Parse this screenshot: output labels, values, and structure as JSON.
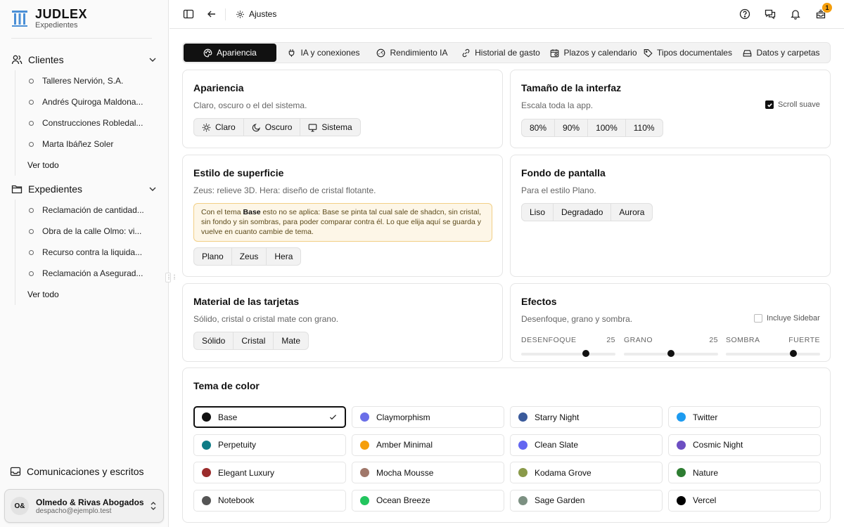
{
  "brand": {
    "title": "JUDLEX",
    "subtitle": "Expedientes"
  },
  "sidebar": {
    "clientes": {
      "label": "Clientes",
      "items": [
        "Talleres Nervión, S.A.",
        "Andrés Quiroga Maldona...",
        "Construcciones Robledal...",
        "Marta Ibáñez Soler"
      ],
      "all": "Ver todo"
    },
    "expedientes": {
      "label": "Expedientes",
      "items": [
        "Reclamación de cantidad...",
        "Obra de la calle Olmo: vi...",
        "Recurso contra la liquida...",
        "Reclamación a Asegurad..."
      ],
      "all": "Ver todo"
    },
    "comunicaciones": "Comunicaciones y escritos",
    "account": {
      "initials": "O&",
      "name": "Olmedo & Rivas Abogados",
      "email": "despacho@ejemplo.test"
    }
  },
  "topbar": {
    "breadcrumb": "Ajustes",
    "notifications_badge": "1"
  },
  "tabs": [
    {
      "label": "Apariencia",
      "icon": "palette-icon",
      "active": true
    },
    {
      "label": "IA y conexiones",
      "icon": "plug-icon"
    },
    {
      "label": "Rendimiento IA",
      "icon": "gauge-icon"
    },
    {
      "label": "Historial de gasto",
      "icon": "link-icon"
    },
    {
      "label": "Plazos y calendario",
      "icon": "calendar-icon"
    },
    {
      "label": "Tipos documentales",
      "icon": "tag-icon"
    },
    {
      "label": "Datos y carpetas",
      "icon": "drive-icon"
    }
  ],
  "apariencia": {
    "title": "Apariencia",
    "subtitle": "Claro, oscuro o el del sistema.",
    "options": [
      "Claro",
      "Oscuro",
      "Sistema"
    ]
  },
  "tamano": {
    "title": "Tamaño de la interfaz",
    "subtitle": "Escala toda la app.",
    "options": [
      "80%",
      "90%",
      "100%",
      "110%"
    ],
    "scroll_label": "Scroll suave",
    "scroll_checked": true
  },
  "superficie": {
    "title": "Estilo de superficie",
    "subtitle": "Zeus: relieve 3D. Hera: diseño de cristal flotante.",
    "note_pre": "Con el tema ",
    "note_bold": "Base",
    "note_post": " esto no se aplica: Base se pinta tal cual sale de shadcn, sin cristal, sin fondo y sin sombras, para poder comparar contra él. Lo que elija aquí se guarda y vuelve en cuanto cambie de tema.",
    "options": [
      "Plano",
      "Zeus",
      "Hera"
    ]
  },
  "fondo": {
    "title": "Fondo de pantalla",
    "subtitle": "Para el estilo Plano.",
    "options": [
      "Liso",
      "Degradado",
      "Aurora"
    ]
  },
  "material": {
    "title": "Material de las tarjetas",
    "subtitle": "Sólido, cristal o cristal mate con grano.",
    "options": [
      "Sólido",
      "Cristal",
      "Mate"
    ]
  },
  "efectos": {
    "title": "Efectos",
    "subtitle": "Desenfoque, grano y sombra.",
    "sidebar_label": "Incluye Sidebar",
    "sidebar_checked": false,
    "sliders": [
      {
        "label": "DESENFOQUE",
        "value": "25",
        "fraction": 0.69
      },
      {
        "label": "GRANO",
        "value": "25",
        "fraction": 0.5
      },
      {
        "label": "SOMBRA",
        "value": "FUERTE",
        "fraction": 0.72
      }
    ]
  },
  "tema": {
    "title": "Tema de color",
    "selected": "Base",
    "themes": [
      {
        "name": "Base",
        "color": "#111111"
      },
      {
        "name": "Claymorphism",
        "color": "#6b6fe8"
      },
      {
        "name": "Starry Night",
        "color": "#3a5a9b"
      },
      {
        "name": "Twitter",
        "color": "#1d9bf0"
      },
      {
        "name": "Perpetuity",
        "color": "#0e7c86"
      },
      {
        "name": "Amber Minimal",
        "color": "#f59e0b"
      },
      {
        "name": "Clean Slate",
        "color": "#6366f1"
      },
      {
        "name": "Cosmic Night",
        "color": "#6d4fc2"
      },
      {
        "name": "Elegant Luxury",
        "color": "#9b2c2c"
      },
      {
        "name": "Mocha Mousse",
        "color": "#a0776a"
      },
      {
        "name": "Kodama Grove",
        "color": "#8a9a4a"
      },
      {
        "name": "Nature",
        "color": "#2e7d32"
      },
      {
        "name": "Notebook",
        "color": "#555555"
      },
      {
        "name": "Ocean Breeze",
        "color": "#22c55e"
      },
      {
        "name": "Sage Garden",
        "color": "#7c9082"
      },
      {
        "name": "Vercel",
        "color": "#000000"
      }
    ]
  }
}
